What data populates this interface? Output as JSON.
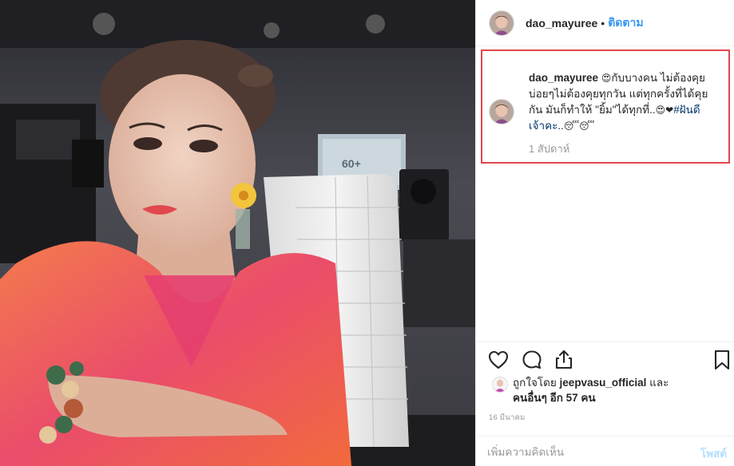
{
  "photo": {
    "icon": "selfie-photo",
    "sign_text": "60+"
  },
  "header": {
    "username": "dao_mayuree",
    "separator": "•",
    "follow_label": "ติดตาม"
  },
  "caption": {
    "username": "dao_mayuree",
    "line1_emoji": "😍",
    "line1_text": "กับบางคน ไม่ต้องคุย",
    "line2_text": "บ่อยๆไม่ต้องคุยทุกวัน แต่ทุกครั้งที่ได้คุย",
    "line3_text": "กัน มันก็ทำให้ \"ยิ้ม\"ได้ทุกที่..",
    "line3_emoji": "😍❤",
    "hashtag": "#ฝันดี",
    "line4_text": "เจ้าคะ..",
    "line4_emoji": "😴😴",
    "time_ago": "1 สัปดาห์"
  },
  "actions": {
    "like_icon": "heart-outline",
    "comment_icon": "speech-bubble",
    "share_icon": "share-upload",
    "save_icon": "bookmark"
  },
  "likes": {
    "prefix": "ถูกใจโดย",
    "liker": "jeepvasu_official",
    "conjunction": "และ",
    "others": "คนอื่นๆ อีก 57 คน"
  },
  "post_date": "16 มีนาคม",
  "comment": {
    "placeholder": "เพิ่มความคิดเห็น",
    "post_label": "โพสต์"
  },
  "colors": {
    "link_blue": "#3897f0",
    "hashtag_blue": "#003569",
    "highlight_red": "#e0474c",
    "muted_gray": "#999999",
    "post_disabled": "#b2dffc"
  }
}
